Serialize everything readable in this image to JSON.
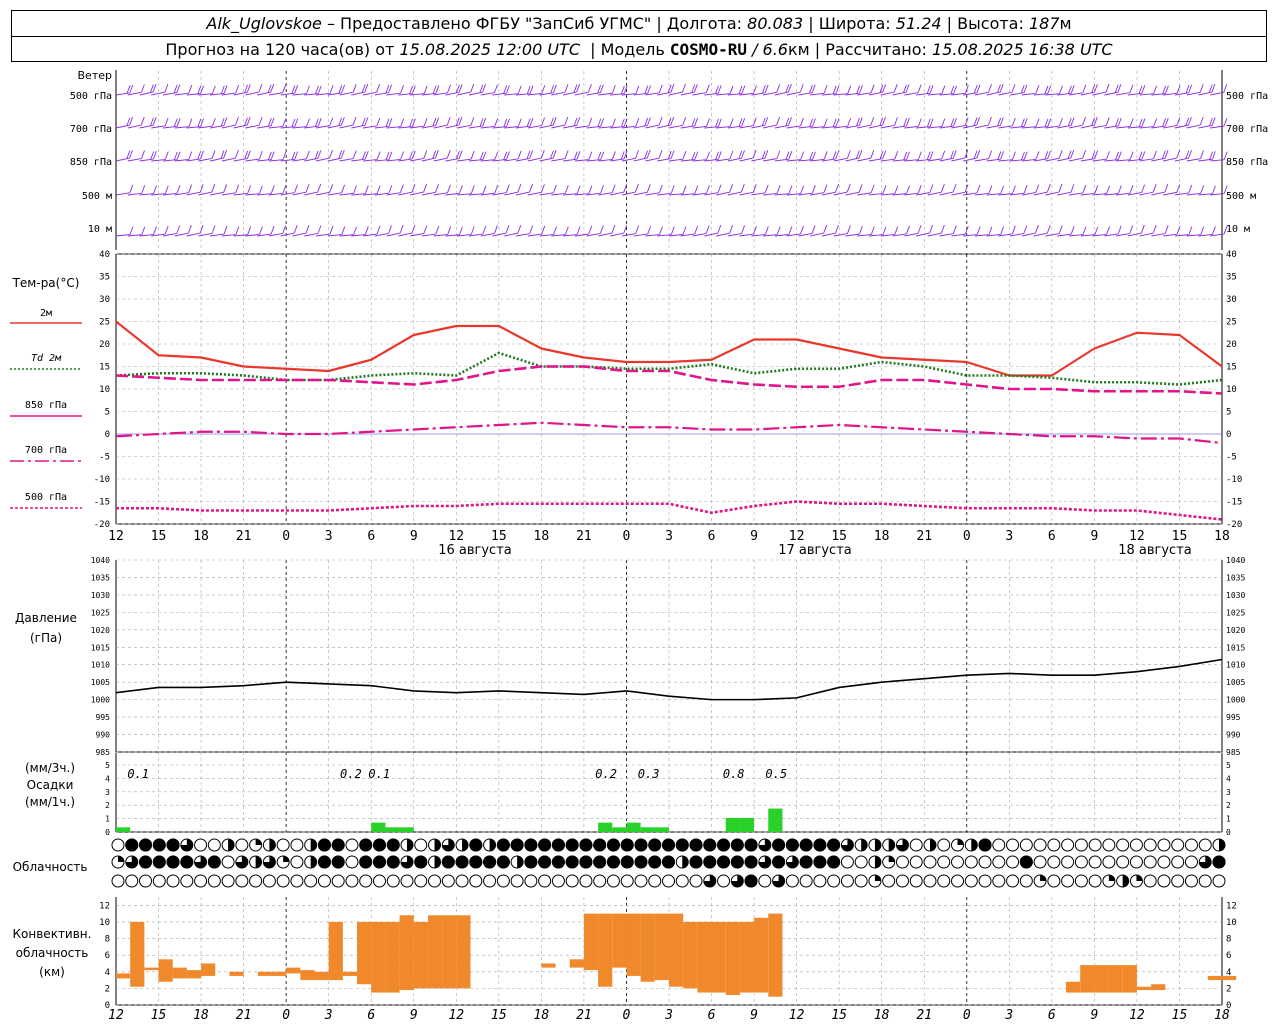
{
  "header": {
    "station": "Alk_Uglovskoe",
    "sep1": "–",
    "provided": "Предоставлено ФГБУ \"ЗапСиб УГМС\"",
    "lon_label": "Долгота:",
    "lon_value": "80.083",
    "lat_label": "Широта:",
    "lat_value": "51.24",
    "alt_label": "Высота:",
    "alt_value": "187",
    "alt_unit": "м",
    "forecast_prefix": "Прогноз на 120 часа(ов) от",
    "forecast_time": "15.08.2025 12:00 UTC",
    "model_label": "Модель",
    "model_name": "COSMO-RU",
    "model_res_pre": "/ 6.6",
    "model_res_unit": "км",
    "calc_label": "Рассчитано:",
    "calc_time": "15.08.2025 16:38 UTC"
  },
  "wind_panel": {
    "title": "Ветер",
    "levels": [
      "500 гПа",
      "700 гПа",
      "850 гПа",
      "500 м",
      "10 м"
    ],
    "barb_color": "#8a2be2"
  },
  "temp_panel": {
    "title": "Тем-ра(°С)",
    "legend": [
      {
        "label": "2м",
        "color": "#e8382e",
        "style": "solid"
      },
      {
        "label": "Td 2м",
        "color": "#1f7a1f",
        "style": "dotted"
      },
      {
        "label": "850 гПа",
        "color": "#e0158a",
        "style": "dashed"
      },
      {
        "label": "700 гПа",
        "color": "#e0158a",
        "style": "dashdot"
      },
      {
        "label": "500 гПа",
        "color": "#e0158a",
        "style": "dense"
      }
    ],
    "ticks": [
      "40",
      "35",
      "30",
      "25",
      "20",
      "15",
      "10",
      "5",
      "0",
      "-5",
      "-10",
      "-15",
      "-20"
    ],
    "day_labels": [
      "16 августа",
      "17 августа",
      "18 августа"
    ]
  },
  "pressure_panel": {
    "title": "Давление",
    "unit": "(гПа)",
    "ticks": [
      "1040",
      "1035",
      "1030",
      "1025",
      "1020",
      "1015",
      "1010",
      "1005",
      "1000",
      "995",
      "990",
      "985"
    ]
  },
  "precip_panel": {
    "label1": "(мм/3ч.)",
    "label2": "Осадки",
    "label3": "(мм/1ч.)",
    "ticks": [
      "5",
      "4",
      "3",
      "2",
      "1",
      "0"
    ],
    "annotations": [
      "0.1",
      "0.2",
      "0.1",
      "0.2",
      "0.3",
      "0.8",
      "0.5"
    ],
    "bar_color": "#2bd12b"
  },
  "cloud_panel": {
    "title": "Облачность"
  },
  "conv_panel": {
    "label1": "Конвективн.",
    "label2": "облачность",
    "label3": "(км)",
    "ticks": [
      "12",
      "10",
      "8",
      "6",
      "4",
      "2",
      "0"
    ],
    "bar_color": "#f0892b"
  },
  "time_axis": {
    "hour_labels": [
      "12",
      "15",
      "18",
      "21",
      "0",
      "3",
      "6",
      "9",
      "12",
      "15",
      "18",
      "21",
      "0",
      "3",
      "6",
      "9",
      "12",
      "15",
      "18",
      "21",
      "0",
      "3",
      "6",
      "9",
      "12",
      "15",
      "18"
    ]
  },
  "chart_data": {
    "type": "line",
    "x": [
      0,
      3,
      6,
      9,
      12,
      15,
      18,
      21,
      24,
      27,
      30,
      33,
      36,
      39,
      42,
      45,
      48,
      51,
      54,
      57,
      60,
      63,
      66,
      69,
      72,
      75,
      78
    ],
    "x_tick_labels": [
      "12",
      "15",
      "18",
      "21",
      "0",
      "3",
      "6",
      "9",
      "12",
      "15",
      "18",
      "21",
      "0",
      "3",
      "6",
      "9",
      "12",
      "15",
      "18",
      "21",
      "0",
      "3",
      "6",
      "9",
      "12",
      "15",
      "18"
    ],
    "temperature": {
      "ylim": [
        -20,
        40
      ],
      "series": [
        {
          "name": "2м",
          "values": [
            25,
            17.5,
            17,
            15,
            14.5,
            14,
            16.5,
            22,
            24,
            24,
            19,
            17,
            16,
            16,
            16.5,
            21,
            21,
            19,
            17,
            16.5,
            16,
            13,
            13,
            19,
            22.5,
            22,
            15
          ]
        },
        {
          "name": "Td 2м",
          "values": [
            13,
            13.5,
            13.5,
            13,
            12,
            12,
            13,
            13.5,
            13,
            18,
            15,
            15,
            14.5,
            14.5,
            15.5,
            13.5,
            14.5,
            14.5,
            16,
            15,
            13,
            13,
            12.5,
            11.5,
            11.5,
            11,
            12
          ]
        },
        {
          "name": "850 гПа",
          "values": [
            13,
            12.5,
            12,
            12,
            12,
            12,
            11.5,
            11,
            12,
            14,
            15,
            15,
            14,
            14,
            12,
            11,
            10.5,
            10.5,
            12,
            12,
            11,
            10,
            10,
            9.5,
            9.5,
            9.5,
            9
          ]
        },
        {
          "name": "700 гПа",
          "values": [
            -0.5,
            0,
            0.5,
            0.5,
            0,
            0,
            0.5,
            1,
            1.5,
            2,
            2.5,
            2,
            1.5,
            1.5,
            1,
            1,
            1.5,
            2,
            1.5,
            1,
            0.5,
            0,
            -0.5,
            -0.5,
            -1,
            -1,
            -2
          ]
        },
        {
          "name": "500 гПа",
          "values": [
            -16.5,
            -16.5,
            -17,
            -17,
            -17,
            -17,
            -16.5,
            -16,
            -16,
            -15.5,
            -15.5,
            -15.5,
            -15.5,
            -15.5,
            -17.5,
            -16,
            -15,
            -15.5,
            -15.5,
            -16,
            -16.5,
            -16.5,
            -16.5,
            -17,
            -17,
            -18,
            -19
          ]
        }
      ]
    },
    "pressure": {
      "ylim": [
        985,
        1040
      ],
      "values": [
        1002,
        1003.5,
        1003.5,
        1004,
        1005,
        1004.5,
        1004,
        1002.5,
        1002,
        1002.5,
        1002,
        1001.5,
        1002.5,
        1001,
        1000,
        1000,
        1000.5,
        1003.5,
        1005,
        1006,
        1007,
        1007.5,
        1007,
        1007,
        1008,
        1009.5,
        1011.5
      ]
    },
    "precipitation_annotations_mm_3h": [
      {
        "x": 1,
        "value": 0.1
      },
      {
        "x": 16,
        "value": 0.2
      },
      {
        "x": 18,
        "value": 0.1
      },
      {
        "x": 34,
        "value": 0.2
      },
      {
        "x": 37,
        "value": 0.3
      },
      {
        "x": 43,
        "value": 0.8
      },
      {
        "x": 46,
        "value": 0.5
      }
    ],
    "precipitation_mm_1h": [
      {
        "x": 0,
        "value": 0.1
      },
      {
        "x": 18,
        "value": 0.2
      },
      {
        "x": 19,
        "value": 0.1
      },
      {
        "x": 20,
        "value": 0.1
      },
      {
        "x": 34,
        "value": 0.2
      },
      {
        "x": 35,
        "value": 0.1
      },
      {
        "x": 36,
        "value": 0.2
      },
      {
        "x": 37,
        "value": 0.1
      },
      {
        "x": 38,
        "value": 0.1
      },
      {
        "x": 43,
        "value": 0.3
      },
      {
        "x": 44,
        "value": 0.3
      },
      {
        "x": 46,
        "value": 0.5
      }
    ],
    "convective_cloud_km": [
      {
        "x": 0,
        "base": 3.2,
        "top": 3.8
      },
      {
        "x": 1,
        "base": 2.2,
        "top": 10
      },
      {
        "x": 2,
        "base": 4.2,
        "top": 4.5
      },
      {
        "x": 3,
        "base": 2.8,
        "top": 5.5
      },
      {
        "x": 4,
        "base": 3.2,
        "top": 4.5
      },
      {
        "x": 5,
        "base": 3.2,
        "top": 4.2
      },
      {
        "x": 6,
        "base": 3.5,
        "top": 5
      },
      {
        "x": 8,
        "base": 3.5,
        "top": 4
      },
      {
        "x": 10,
        "base": 3.5,
        "top": 4
      },
      {
        "x": 11,
        "base": 3.5,
        "top": 4
      },
      {
        "x": 12,
        "base": 3.8,
        "top": 4.5
      },
      {
        "x": 13,
        "base": 3,
        "top": 4.2
      },
      {
        "x": 14,
        "base": 3,
        "top": 4
      },
      {
        "x": 15,
        "base": 3,
        "top": 10
      },
      {
        "x": 16,
        "base": 3.5,
        "top": 4
      },
      {
        "x": 17,
        "base": 2.5,
        "top": 10
      },
      {
        "x": 18,
        "base": 1.5,
        "top": 10
      },
      {
        "x": 19,
        "base": 1.5,
        "top": 10
      },
      {
        "x": 20,
        "base": 1.8,
        "top": 10.8
      },
      {
        "x": 21,
        "base": 2,
        "top": 10
      },
      {
        "x": 22,
        "base": 2,
        "top": 10.8
      },
      {
        "x": 23,
        "base": 2,
        "top": 10.8
      },
      {
        "x": 24,
        "base": 2,
        "top": 10.8
      },
      {
        "x": 30,
        "base": 4.5,
        "top": 5
      },
      {
        "x": 32,
        "base": 4.5,
        "top": 5.5
      },
      {
        "x": 33,
        "base": 4.2,
        "top": 11
      },
      {
        "x": 34,
        "base": 2.2,
        "top": 11
      },
      {
        "x": 35,
        "base": 4.5,
        "top": 11
      },
      {
        "x": 36,
        "base": 3.5,
        "top": 11
      },
      {
        "x": 37,
        "base": 2.8,
        "top": 11
      },
      {
        "x": 38,
        "base": 3,
        "top": 11
      },
      {
        "x": 39,
        "base": 2.2,
        "top": 11
      },
      {
        "x": 40,
        "base": 2,
        "top": 10
      },
      {
        "x": 41,
        "base": 1.5,
        "top": 10
      },
      {
        "x": 42,
        "base": 1.5,
        "top": 10
      },
      {
        "x": 43,
        "base": 1.2,
        "top": 10
      },
      {
        "x": 44,
        "base": 1.5,
        "top": 10
      },
      {
        "x": 45,
        "base": 1.5,
        "top": 10.5
      },
      {
        "x": 46,
        "base": 1,
        "top": 11
      },
      {
        "x": 67,
        "base": 1.5,
        "top": 2.8
      },
      {
        "x": 68,
        "base": 1.5,
        "top": 4.8
      },
      {
        "x": 69,
        "base": 1.5,
        "top": 4.8
      },
      {
        "x": 70,
        "base": 1.5,
        "top": 4.8
      },
      {
        "x": 71,
        "base": 1.5,
        "top": 4.8
      },
      {
        "x": 72,
        "base": 1.8,
        "top": 2.2
      },
      {
        "x": 73,
        "base": 1.8,
        "top": 2.5
      },
      {
        "x": 77,
        "base": 3,
        "top": 3.5
      },
      {
        "x": 78,
        "base": 3,
        "top": 3.5
      }
    ],
    "cloud_cover_oktas": {
      "upper": [
        0,
        8,
        8,
        8,
        8,
        6,
        0,
        0,
        4,
        0,
        2,
        4,
        0,
        0,
        4,
        8,
        8,
        0,
        8,
        8,
        8,
        4,
        0,
        4,
        6,
        4,
        8,
        4,
        8,
        8,
        8,
        8,
        8,
        8,
        8,
        8,
        8,
        8,
        8,
        8,
        8,
        8,
        8,
        8,
        8,
        8,
        8,
        6,
        8,
        8,
        8,
        8,
        8,
        6,
        4,
        4,
        4,
        6,
        0,
        4,
        0,
        2,
        4,
        8,
        0,
        0,
        0,
        0,
        0,
        0,
        0,
        0,
        0,
        0,
        0,
        0,
        0,
        0,
        0,
        0,
        4
      ],
      "middle": [
        2,
        6,
        8,
        8,
        8,
        8,
        6,
        8,
        0,
        6,
        4,
        6,
        2,
        0,
        4,
        8,
        8,
        0,
        8,
        8,
        8,
        6,
        8,
        4,
        8,
        8,
        8,
        8,
        8,
        4,
        8,
        8,
        8,
        8,
        8,
        8,
        8,
        8,
        8,
        8,
        8,
        4,
        8,
        8,
        8,
        8,
        8,
        6,
        8,
        6,
        8,
        8,
        8,
        0,
        0,
        4,
        2,
        0,
        0,
        0,
        0,
        0,
        0,
        0,
        0,
        0,
        8,
        0,
        0,
        0,
        0,
        0,
        0,
        0,
        0,
        0,
        0,
        0,
        0,
        6,
        8
      ],
      "lower": [
        0,
        0,
        0,
        0,
        0,
        0,
        0,
        0,
        0,
        0,
        0,
        0,
        0,
        0,
        0,
        0,
        0,
        0,
        0,
        0,
        0,
        0,
        0,
        0,
        0,
        0,
        0,
        0,
        0,
        0,
        0,
        0,
        0,
        0,
        0,
        0,
        0,
        0,
        0,
        0,
        0,
        0,
        0,
        6,
        0,
        6,
        8,
        0,
        6,
        0,
        0,
        0,
        0,
        0,
        0,
        2,
        0,
        0,
        0,
        0,
        0,
        0,
        0,
        0,
        0,
        0,
        0,
        2,
        0,
        0,
        0,
        0,
        2,
        4,
        2,
        0,
        0,
        0,
        0,
        0,
        0
      ]
    }
  }
}
